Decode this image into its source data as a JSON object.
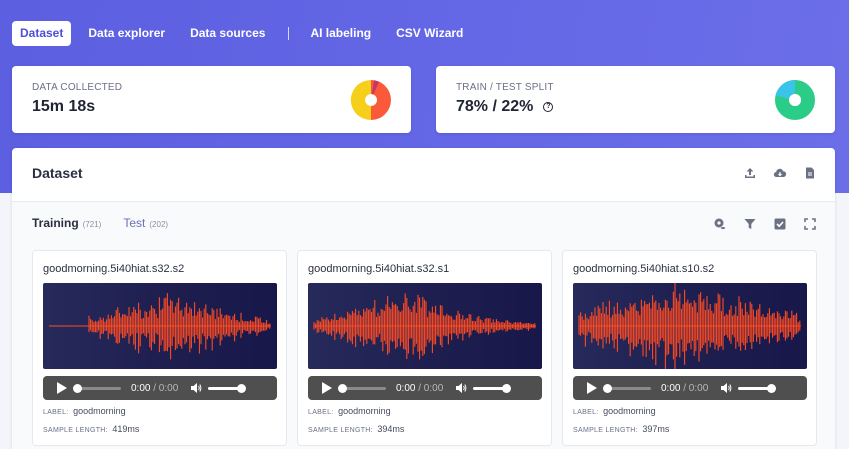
{
  "nav": {
    "items": [
      {
        "label": "Dataset",
        "active": true
      },
      {
        "label": "Data explorer",
        "active": false
      },
      {
        "label": "Data sources",
        "active": false
      },
      {
        "label": "AI labeling",
        "active": false
      },
      {
        "label": "CSV Wizard",
        "active": false
      }
    ]
  },
  "stats": {
    "collected": {
      "label": "DATA COLLECTED",
      "value": "15m 18s",
      "colors": [
        "#fb5a3a",
        "#f6cf1b",
        "#c9356a"
      ]
    },
    "split": {
      "label": "TRAIN / TEST SPLIT",
      "value": "78% / 22%",
      "train_pct": 78,
      "test_pct": 22,
      "colors": [
        "#2bcc87",
        "#3bc4ea"
      ]
    }
  },
  "panel": {
    "title": "Dataset",
    "actions": [
      "upload-icon",
      "cloud-icon",
      "file-icon"
    ],
    "tabs": [
      {
        "label": "Training",
        "count": "(721)",
        "active": true
      },
      {
        "label": "Test",
        "count": "(202)",
        "active": false
      }
    ],
    "tools": [
      "settings-eye-icon",
      "filter-icon",
      "checkbox-icon",
      "fullscreen-icon"
    ]
  },
  "samples": [
    {
      "name": "goodmorning.5i40hiat.s32.s2",
      "label_key": "LABEL:",
      "label": "goodmorning",
      "length_key": "SAMPLE LENGTH:",
      "length": "419ms",
      "time": "0:00",
      "total": "/ 0:00"
    },
    {
      "name": "goodmorning.5i40hiat.s32.s1",
      "label_key": "LABEL:",
      "label": "goodmorning",
      "length_key": "SAMPLE LENGTH:",
      "length": "394ms",
      "time": "0:00",
      "total": "/ 0:00"
    },
    {
      "name": "goodmorning.5i40hiat.s10.s2",
      "label_key": "LABEL:",
      "label": "goodmorning",
      "length_key": "SAMPLE LENGTH:",
      "length": "397ms",
      "time": "0:00",
      "total": "/ 0:00"
    }
  ],
  "colors": {
    "accent": "#5b5fe0",
    "waveform": "#ff4b22"
  }
}
